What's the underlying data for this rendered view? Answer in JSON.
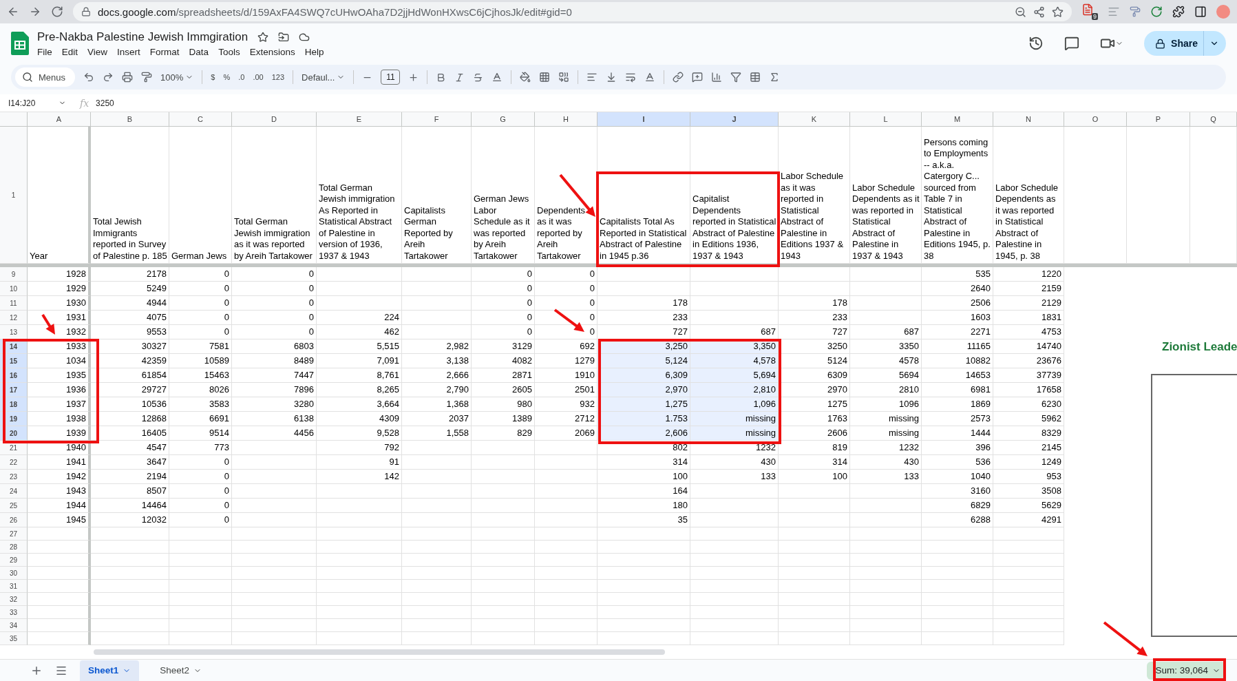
{
  "browser": {
    "domain": "docs.google.com",
    "path": "/spreadsheets/d/159AxFA4SWQ7cUHwOAha7D2jjHdWonHXwsC6jCjhosJk/edit#gid=0",
    "extension_badge": "9"
  },
  "document": {
    "title": "Pre-Nakba Palestine Jewish Immgiration",
    "menus": [
      "File",
      "Edit",
      "View",
      "Insert",
      "Format",
      "Data",
      "Tools",
      "Extensions",
      "Help"
    ],
    "share": "Share"
  },
  "toolbar": {
    "search": "Menus",
    "zoom": "100%",
    "currency": "$",
    "percent": "%",
    "decrease_decimals": ".0",
    "increase_decimals": ".00",
    "number_format": "123",
    "font": "Defaul...",
    "font_size": "11"
  },
  "formula_bar": {
    "name_box": "I14:J20",
    "fx": "fx",
    "value": "3250"
  },
  "columns": [
    {
      "letter": "A",
      "selected": false
    },
    {
      "letter": "B",
      "selected": false
    },
    {
      "letter": "C",
      "selected": false
    },
    {
      "letter": "D",
      "selected": false
    },
    {
      "letter": "E",
      "selected": false
    },
    {
      "letter": "F",
      "selected": false
    },
    {
      "letter": "G",
      "selected": false
    },
    {
      "letter": "H",
      "selected": false
    },
    {
      "letter": "I",
      "selected": true
    },
    {
      "letter": "J",
      "selected": true
    },
    {
      "letter": "K",
      "selected": false
    },
    {
      "letter": "L",
      "selected": false
    },
    {
      "letter": "M",
      "selected": false
    },
    {
      "letter": "N",
      "selected": false
    },
    {
      "letter": "O",
      "selected": false
    },
    {
      "letter": "P",
      "selected": false
    },
    {
      "letter": "Q",
      "selected": false
    }
  ],
  "header_row": {
    "number": "1",
    "cells": {
      "A": "Year",
      "B": "Total Jewish Immigrants reported in Survey of Palestine p. 185",
      "C": "German Jews",
      "D": "Total German Jewish immigration as it was reported by Areih Tartakower",
      "E": "Total German Jewish immigration As Reported in Statistical Abstract of Palestine in version  of 1936, 1937 & 1943",
      "F": "Capitalists German Reported by Areih Tartakower",
      "G": "German Jews Labor Schedule  as it was reported by Areih Tartakower",
      "H": "Dependents as it was reported by Areih Tartakower",
      "I": "Capitalists Total As Reported in Statistical Abstract of Palestine in 1945 p.36",
      "J": "Capitalist Dependents reported  in Statistical Abstract of Palestine in Editions 1936, 1937 & 1943",
      "K": "Labor Schedule as it was reported in Statistical Abstract of Palestine in Editions 1937 & 1943",
      "L": "Labor Schedule Dependents as it was reported in Statistical Abstract of Palestine in 1937 & 1943",
      "M": "Persons coming to Employments -- a.k.a. Catergory C... sourced from Table 7 in Statistical Abstract of Palestine in Editions 1945, p. 38",
      "N": "Labor Schedule Dependents as it was reported in Statistical Abstract of Palestine in 1945, p. 38"
    }
  },
  "rows": [
    {
      "number": "9",
      "selected": false,
      "cells": {
        "A": "1928",
        "B": "2178",
        "C": "0",
        "D": "0",
        "G": "0",
        "H": "0",
        "M": "535",
        "N": "1220"
      }
    },
    {
      "number": "10",
      "selected": false,
      "cells": {
        "A": "1929",
        "B": "5249",
        "C": "0",
        "D": "0",
        "G": "0",
        "H": "0",
        "M": "2640",
        "N": "2159"
      }
    },
    {
      "number": "11",
      "selected": false,
      "cells": {
        "A": "1930",
        "B": "4944",
        "C": "0",
        "D": "0",
        "G": "0",
        "H": "0",
        "I": "178",
        "K": "178",
        "M": "2506",
        "N": "2129"
      }
    },
    {
      "number": "12",
      "selected": false,
      "cells": {
        "A": "1931",
        "B": "4075",
        "C": "0",
        "D": "0",
        "E": "224",
        "G": "0",
        "H": "0",
        "I": "233",
        "K": "233",
        "M": "1603",
        "N": "1831"
      }
    },
    {
      "number": "13",
      "selected": false,
      "cells": {
        "A": "1932",
        "B": "9553",
        "C": "0",
        "D": "0",
        "E": "462",
        "G": "0",
        "H": "0",
        "I": "727",
        "J": "687",
        "K": "727",
        "L": "687",
        "M": "2271",
        "N": "4753"
      }
    },
    {
      "number": "14",
      "selected": true,
      "cells": {
        "A": "1933",
        "B": "30327",
        "C": "7581",
        "D": "6803",
        "E": "5,515",
        "F": "2,982",
        "G": "3129",
        "H": "692",
        "I": "3,250",
        "J": "3,350",
        "K": "3250",
        "L": "3350",
        "M": "11165",
        "N": "14740"
      }
    },
    {
      "number": "15",
      "selected": true,
      "cells": {
        "A": "1034",
        "B": "42359",
        "C": "10589",
        "D": "8489",
        "E": "7,091",
        "F": "3,138",
        "G": "4082",
        "H": "1279",
        "I": "5,124",
        "J": "4,578",
        "K": "5124",
        "L": "4578",
        "M": "10882",
        "N": "23676"
      }
    },
    {
      "number": "16",
      "selected": true,
      "cells": {
        "A": "1935",
        "B": "61854",
        "C": "15463",
        "D": "7447",
        "E": "8,761",
        "F": "2,666",
        "G": "2871",
        "H": "1910",
        "I": "6,309",
        "J": "5,694",
        "K": "6309",
        "L": "5694",
        "M": "14653",
        "N": "37739"
      }
    },
    {
      "number": "17",
      "selected": true,
      "cells": {
        "A": "1936",
        "B": "29727",
        "C": "8026",
        "D": "7896",
        "E": "8,265",
        "F": "2,790",
        "G": "2605",
        "H": "2501",
        "I": "2,970",
        "J": "2,810",
        "K": "2970",
        "L": "2810",
        "M": "6981",
        "N": "17658"
      }
    },
    {
      "number": "18",
      "selected": true,
      "cells": {
        "A": "1937",
        "B": "10536",
        "C": "3583",
        "D": "3280",
        "E": "3,664",
        "F": "1,368",
        "G": "980",
        "H": "932",
        "I": "1,275",
        "J": "1,096",
        "K": "1275",
        "L": "1096",
        "M": "1869",
        "N": "6230"
      }
    },
    {
      "number": "19",
      "selected": true,
      "cells": {
        "A": "1938",
        "B": "12868",
        "C": "6691",
        "D": "6138",
        "E": "4309",
        "F": "2037",
        "G": "1389",
        "H": "2712",
        "I": "1.753",
        "J": "missing",
        "K": "1763",
        "L": "missing",
        "M": "2573",
        "N": "5962"
      }
    },
    {
      "number": "20",
      "selected": true,
      "cells": {
        "A": "1939",
        "B": "16405",
        "C": "9514",
        "D": "4456",
        "E": "9,528",
        "F": "1,558",
        "G": "829",
        "H": "2069",
        "I": "2,606",
        "J": "missing",
        "K": "2606",
        "L": "missing",
        "M": "1444",
        "N": "8329"
      }
    },
    {
      "number": "21",
      "selected": false,
      "cells": {
        "A": "1940",
        "B": "4547",
        "C": "773",
        "E": "792",
        "I": "802",
        "J": "1232",
        "K": "819",
        "L": "1232",
        "M": "396",
        "N": "2145"
      }
    },
    {
      "number": "22",
      "selected": false,
      "cells": {
        "A": "1941",
        "B": "3647",
        "C": "0",
        "E": "91",
        "I": "314",
        "J": "430",
        "K": "314",
        "L": "430",
        "M": "536",
        "N": "1249"
      }
    },
    {
      "number": "23",
      "selected": false,
      "cells": {
        "A": "1942",
        "B": "2194",
        "C": "0",
        "E": "142",
        "I": "100",
        "J": "133",
        "K": "100",
        "L": "133",
        "M": "1040",
        "N": "953"
      }
    },
    {
      "number": "24",
      "selected": false,
      "cells": {
        "A": "1943",
        "B": "8507",
        "C": "0",
        "I": "164",
        "M": "3160",
        "N": "3508"
      }
    },
    {
      "number": "25",
      "selected": false,
      "cells": {
        "A": "1944",
        "B": "14464",
        "C": "0",
        "I": "180",
        "M": "6829",
        "N": "5629"
      }
    },
    {
      "number": "26",
      "selected": false,
      "cells": {
        "A": "1945",
        "B": "12032",
        "C": "0",
        "I": "35",
        "M": "6288",
        "N": "4291"
      }
    },
    {
      "number": "27",
      "selected": false
    },
    {
      "number": "28",
      "selected": false
    },
    {
      "number": "29",
      "selected": false
    },
    {
      "number": "30",
      "selected": false
    },
    {
      "number": "31",
      "selected": false
    },
    {
      "number": "32",
      "selected": false
    },
    {
      "number": "33",
      "selected": false
    },
    {
      "number": "34",
      "selected": false
    },
    {
      "number": "35",
      "selected": false
    }
  ],
  "embedded_image": {
    "title": "Zionist Leade"
  },
  "sheet_tabs": [
    {
      "label": "Sheet1",
      "selected": true
    },
    {
      "label": "Sheet2",
      "selected": false
    }
  ],
  "status": {
    "sum": "Sum: 39,064"
  }
}
